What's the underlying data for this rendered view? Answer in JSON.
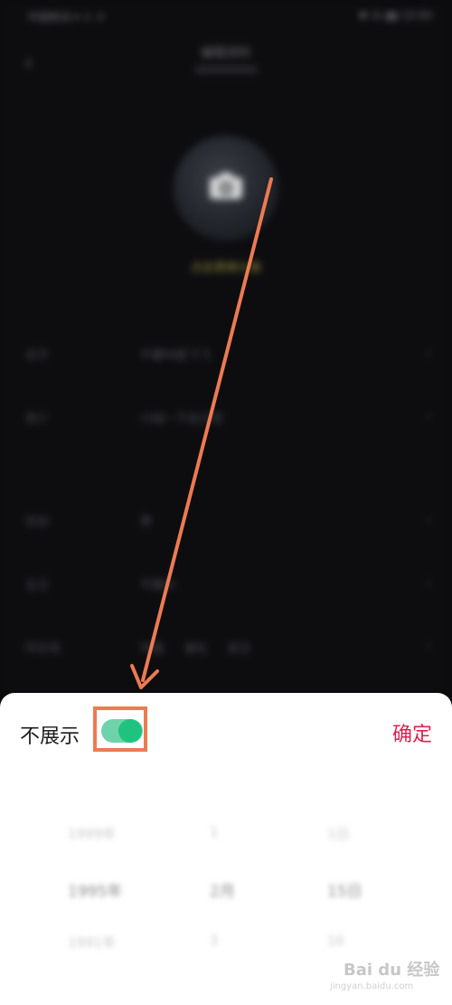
{
  "background": {
    "status_left": "中国移动 ▾ ᯤ ✈",
    "status_right": "✱ ⁂ ▮▮ 10:00",
    "nav_title": "编辑资料",
    "avatar_hint": "点击更换头像",
    "rows": [
      {
        "label": "名字",
        "value": "不要叫我飞飞"
      },
      {
        "label": "简介",
        "value": "介绍一下自己吧"
      },
      {
        "label": "性别",
        "value": "男"
      },
      {
        "label": "生日",
        "value": "不展示"
      },
      {
        "label": "所在地",
        "tags": [
          "中国",
          "湖北",
          "武汉"
        ]
      }
    ]
  },
  "sheet": {
    "toggle_label": "不展示",
    "toggle_on": true,
    "confirm_label": "确定",
    "picker_rows": [
      {
        "c1": "1999年",
        "c2": "1",
        "c3": "1日"
      },
      {
        "c1": "1995年",
        "c2": "2月",
        "c3": "15日"
      },
      {
        "c1": "1991年",
        "c2": "3",
        "c3": "16"
      }
    ]
  },
  "colors": {
    "accent_green": "#1fc37f",
    "confirm_red": "#d8234f",
    "annotation_orange": "#ee7a52"
  },
  "watermark": {
    "brand": "Bai du 经验",
    "url": "jingyan.baidu.com"
  }
}
